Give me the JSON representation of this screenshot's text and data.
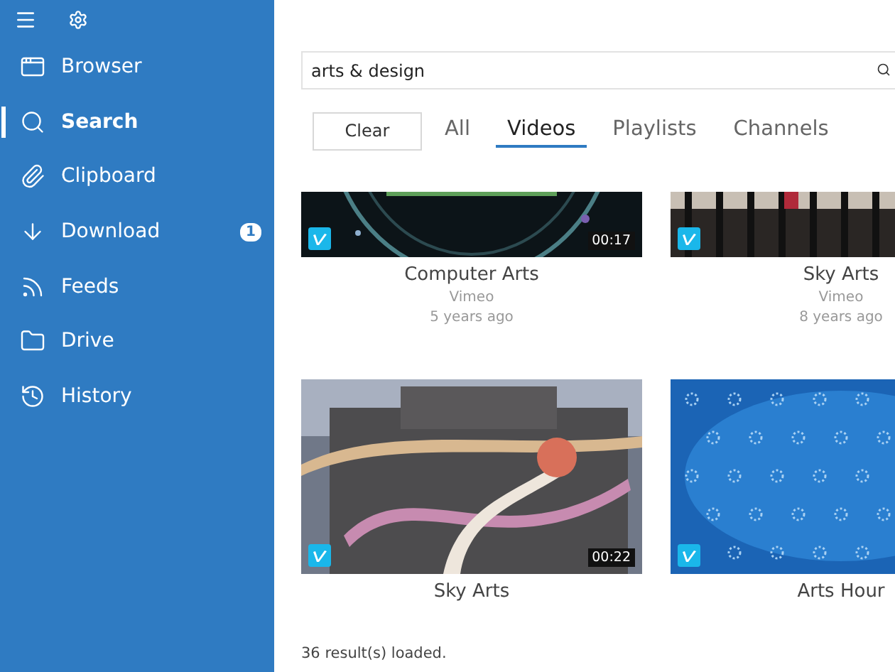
{
  "sidebar": {
    "items": [
      {
        "label": "Browser",
        "selected": false
      },
      {
        "label": "Search",
        "selected": true
      },
      {
        "label": "Clipboard",
        "selected": false
      },
      {
        "label": "Download",
        "selected": false,
        "badge": "1"
      },
      {
        "label": "Feeds",
        "selected": false
      },
      {
        "label": "Drive",
        "selected": false
      },
      {
        "label": "History",
        "selected": false
      }
    ]
  },
  "search": {
    "value": "arts & design"
  },
  "clear_button": "Clear",
  "tabs": [
    {
      "label": "All",
      "selected": false
    },
    {
      "label": "Videos",
      "selected": true
    },
    {
      "label": "Playlists",
      "selected": false
    },
    {
      "label": "Channels",
      "selected": false
    }
  ],
  "results": [
    {
      "title": "Computer Arts",
      "source": "Vimeo",
      "age": "5 years ago",
      "duration": "00:17"
    },
    {
      "title": "Sky Arts",
      "source": "Vimeo",
      "age": "8 years ago"
    },
    {
      "title": "Sky Arts",
      "duration": "00:22"
    },
    {
      "title": "Arts Hour"
    }
  ],
  "status": "36 result(s) loaded."
}
